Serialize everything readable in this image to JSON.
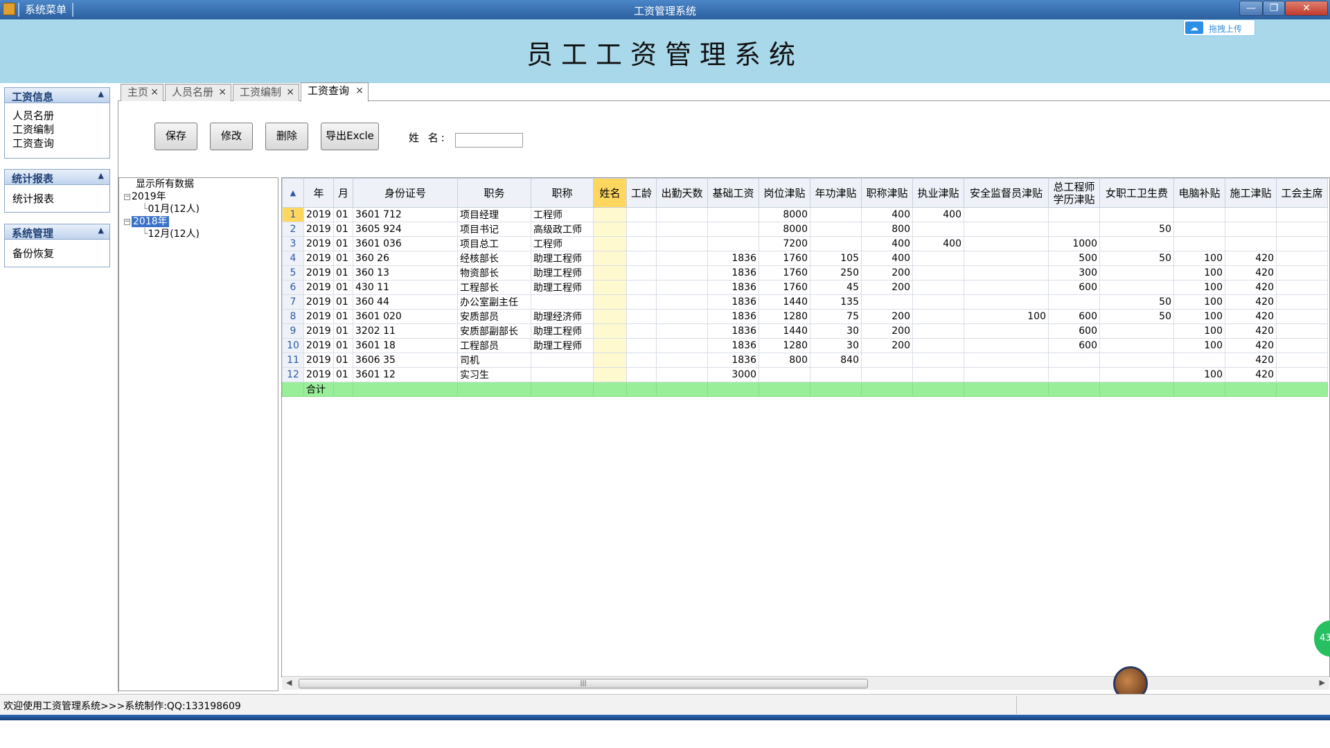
{
  "window": {
    "system_menu": "系统菜单",
    "title": "工资管理系统",
    "min_icon": "—",
    "max_icon": "❐",
    "close_icon": "✕"
  },
  "header": {
    "title": "员工工资管理系统",
    "upload_label": "拖拽上传",
    "upload_icon": "☁"
  },
  "nav": [
    {
      "title": "工资信息",
      "items": [
        "人员名册",
        "工资编制",
        "工资查询"
      ]
    },
    {
      "title": "统计报表",
      "items": [
        "统计报表"
      ]
    },
    {
      "title": "系统管理",
      "items": [
        "备份恢复"
      ]
    }
  ],
  "nav_arrow": "▲",
  "tabs": [
    {
      "label": "主页"
    },
    {
      "label": "人员名册"
    },
    {
      "label": "工资编制"
    },
    {
      "label": "工资查询"
    }
  ],
  "tab_close": "×",
  "toolbar": {
    "save": "保存",
    "edit": "修改",
    "delete": "删除",
    "export": "导出Excle",
    "name_label": "姓 名:",
    "name_value": ""
  },
  "tree": {
    "all": "显示所有数据",
    "year1": "2019年",
    "year1_child": "01月(12人)",
    "year2": "2018年",
    "year2_child": "12月(12人)",
    "collapse_glyph": "−"
  },
  "grid": {
    "corner": "▲",
    "columns": [
      "年",
      "月",
      "身份证号",
      "职务",
      "职称",
      "姓名",
      "工龄",
      "出勤天数",
      "基础工资",
      "岗位津贴",
      "年功津贴",
      "职称津贴",
      "执业津贴",
      "安全监督员津贴",
      "总工程师\n学历津贴",
      "女职工卫生费",
      "电脑补贴",
      "施工津贴",
      "工会主席"
    ],
    "rows": [
      [
        "1",
        "2019",
        "01",
        "3601    712",
        "项目经理",
        "工程师",
        "",
        "",
        "",
        "",
        "8000",
        "",
        "400",
        "400",
        "",
        "",
        "",
        "",
        "",
        ""
      ],
      [
        "2",
        "2019",
        "01",
        "3605    924",
        "项目书记",
        "高级政工师",
        "",
        "",
        "",
        "",
        "8000",
        "",
        "800",
        "",
        "",
        "",
        "50",
        "",
        "",
        ""
      ],
      [
        "3",
        "2019",
        "01",
        "3601    036",
        "项目总工",
        "工程师",
        "",
        "",
        "",
        "",
        "7200",
        "",
        "400",
        "400",
        "",
        "1000",
        "",
        "",
        "",
        ""
      ],
      [
        "4",
        "2019",
        "01",
        "360     26",
        "经核部长",
        "助理工程师",
        "",
        "",
        "",
        "1836",
        "1760",
        "105",
        "400",
        "",
        "",
        "500",
        "50",
        "100",
        "420",
        ""
      ],
      [
        "5",
        "2019",
        "01",
        "360     13",
        "物资部长",
        "助理工程师",
        "",
        "",
        "",
        "1836",
        "1760",
        "250",
        "200",
        "",
        "",
        "300",
        "",
        "100",
        "420",
        ""
      ],
      [
        "6",
        "2019",
        "01",
        "430     11",
        "工程部长",
        "助理工程师",
        "",
        "",
        "",
        "1836",
        "1760",
        "45",
        "200",
        "",
        "",
        "600",
        "",
        "100",
        "420",
        ""
      ],
      [
        "7",
        "2019",
        "01",
        "360     44",
        "办公室副主任",
        "",
        "",
        "",
        "",
        "1836",
        "1440",
        "135",
        "",
        "",
        "",
        "",
        "50",
        "100",
        "420",
        ""
      ],
      [
        "8",
        "2019",
        "01",
        "3601    020",
        "安质部员",
        "助理经济师",
        "",
        "",
        "",
        "1836",
        "1280",
        "75",
        "200",
        "",
        "100",
        "600",
        "50",
        "100",
        "420",
        ""
      ],
      [
        "9",
        "2019",
        "01",
        "3202    11",
        "安质部副部长",
        "助理工程师",
        "",
        "",
        "",
        "1836",
        "1440",
        "30",
        "200",
        "",
        "",
        "600",
        "",
        "100",
        "420",
        ""
      ],
      [
        "10",
        "2019",
        "01",
        "3601    18",
        "工程部员",
        "助理工程师",
        "",
        "",
        "",
        "1836",
        "1280",
        "30",
        "200",
        "",
        "",
        "600",
        "",
        "100",
        "420",
        ""
      ],
      [
        "11",
        "2019",
        "01",
        "3606    35",
        "司机",
        "",
        "",
        "",
        "",
        "1836",
        "800",
        "840",
        "",
        "",
        "",
        "",
        "",
        "",
        "420",
        ""
      ],
      [
        "12",
        "2019",
        "01",
        "3601    12",
        "实习生",
        "",
        "",
        "",
        "",
        "3000",
        "",
        "",
        "",
        "",
        "",
        "",
        "",
        "100",
        "420",
        ""
      ]
    ],
    "total_label": "合计"
  },
  "scroll": {
    "left": "◀",
    "right": "▶",
    "grip": "|||"
  },
  "float_badge": "43",
  "status": {
    "message": "欢迎使用工资管理系统>>>系统制作:QQ:133198609"
  }
}
